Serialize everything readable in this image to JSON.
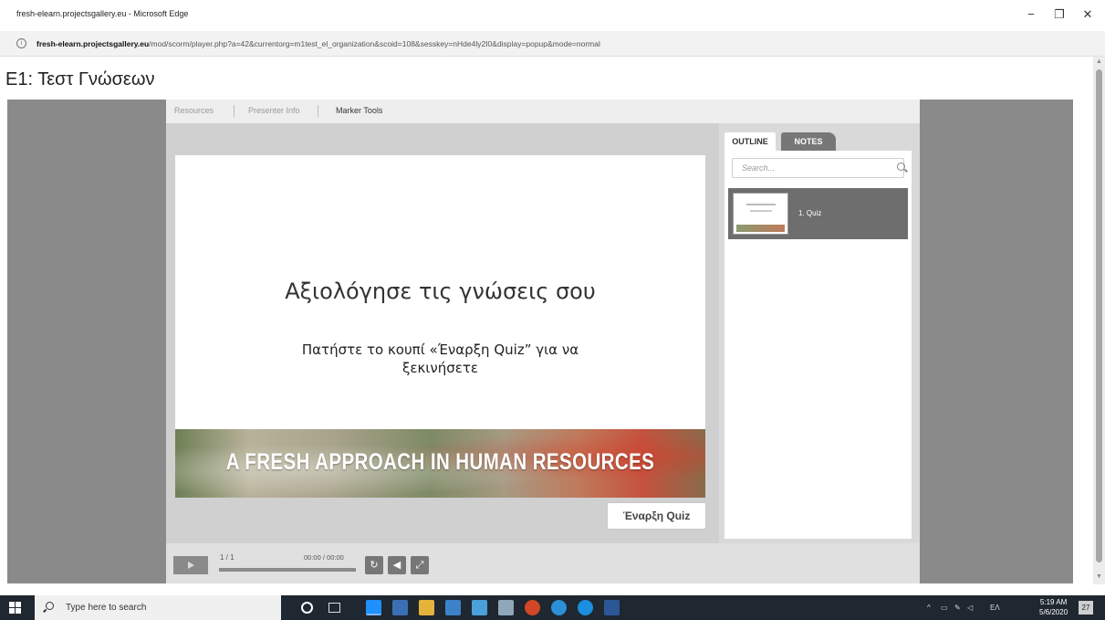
{
  "window": {
    "title": "fresh-elearn.projectsgallery.eu - Microsoft Edge",
    "minimize": "−",
    "maximize": "❐",
    "close": "✕"
  },
  "address": {
    "host": "fresh-elearn.projectsgallery.eu",
    "path": "/mod/scorm/player.php?a=42&currentorg=m1test_el_organization&scoid=108&sesskey=nHde4ly2I0&display=popup&mode=normal"
  },
  "page": {
    "title": "Ε1: Τεστ Γνώσεων"
  },
  "player": {
    "tabs": [
      "Resources",
      "Presenter Info",
      "Marker Tools"
    ],
    "slide": {
      "heading": "Αξιολόγησε τις γνώσεις σου",
      "subtitle": "Πατήστε το κουπί «Έναρξη Quiz” για να ξεκινήσετε",
      "banner": "A FRESH APPROACH IN HUMAN RESOURCES"
    },
    "start_button": "Έναρξη Quiz",
    "sidebar": {
      "tab_outline": "OUTLINE",
      "tab_notes": "NOTES",
      "search_placeholder": "Search...",
      "items": [
        {
          "label": "1. Quiz"
        }
      ]
    },
    "controls": {
      "slide_count": "1 / 1",
      "time": "00:00 / 00:00",
      "progress": 0,
      "icons": [
        "replay-icon",
        "volume-icon",
        "fullscreen-icon"
      ]
    }
  },
  "taskbar": {
    "search_placeholder": "Type here to search",
    "tray_lang": "ΕΛ",
    "time": "5:19 AM",
    "date": "5/6/2020",
    "notifications": "27"
  },
  "colors": {
    "stage": "#8a8a8a",
    "player": "#d9d9d9",
    "taskbar": "#1f2730",
    "notes_tab": "#777777"
  }
}
